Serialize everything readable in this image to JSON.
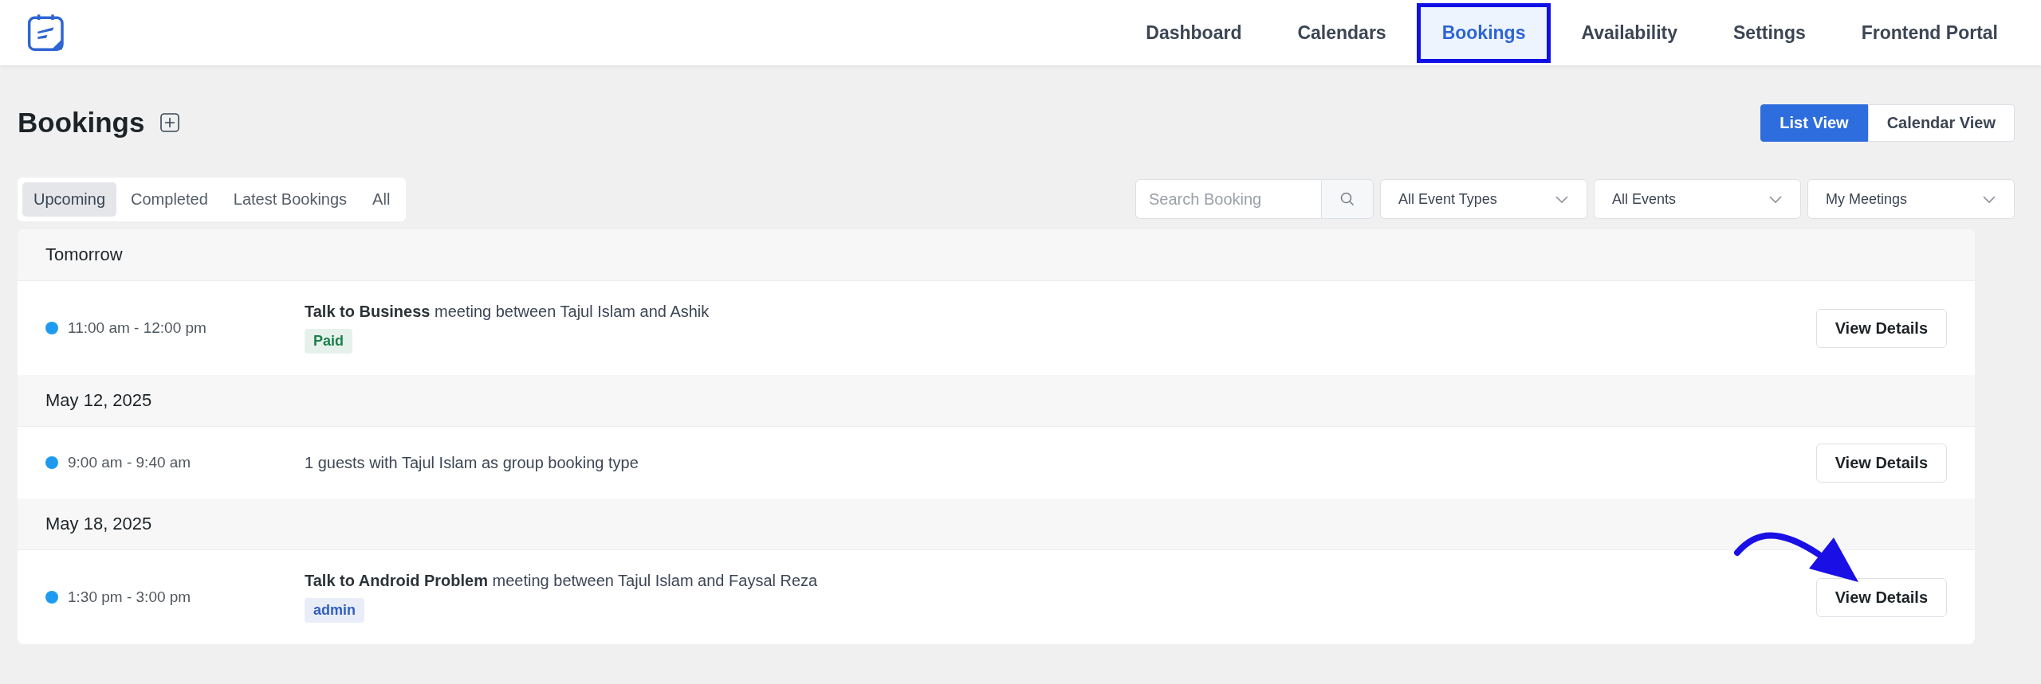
{
  "nav": [
    {
      "label": "Dashboard",
      "selected": false
    },
    {
      "label": "Calendars",
      "selected": false
    },
    {
      "label": "Bookings",
      "selected": true
    },
    {
      "label": "Availability",
      "selected": false
    },
    {
      "label": "Settings",
      "selected": false
    },
    {
      "label": "Frontend Portal",
      "selected": false
    }
  ],
  "page_title": "Bookings",
  "view_toggle": [
    {
      "label": "List View",
      "selected": true
    },
    {
      "label": "Calendar View",
      "selected": false
    }
  ],
  "tabs": [
    {
      "label": "Upcoming",
      "selected": true
    },
    {
      "label": "Completed",
      "selected": false
    },
    {
      "label": "Latest Bookings",
      "selected": false
    },
    {
      "label": "All",
      "selected": false
    }
  ],
  "search": {
    "placeholder": "Search Booking"
  },
  "filters": [
    "All Event Types",
    "All Events",
    "My Meetings"
  ],
  "groups": [
    {
      "heading": "Tomorrow",
      "bookings": [
        {
          "time": "11:00 am - 12:00 pm",
          "color": "#1e9bf0",
          "title": "**Talk to Business** meeting between Tajul Islam and Ashik",
          "tag": {
            "label": "Paid",
            "color": "#1a7f4b"
          },
          "button": "View Details"
        }
      ]
    },
    {
      "heading": "May 12, 2025",
      "bookings": [
        {
          "time": "9:00 am - 9:40 am",
          "color": "#1e9bf0",
          "title": "1 guests with Tajul Islam as group booking type",
          "button": "View Details"
        }
      ]
    },
    {
      "heading": "May 18, 2025",
      "bookings": [
        {
          "time": "1:30 pm - 3:00 pm",
          "color": "#1e9bf0",
          "title": "**Talk to Android Problem** meeting between Tajul Islam and Faysal Reza",
          "tag": {
            "label": "admin",
            "color": "#2f5fc0"
          },
          "button": "View Details"
        }
      ]
    }
  ]
}
